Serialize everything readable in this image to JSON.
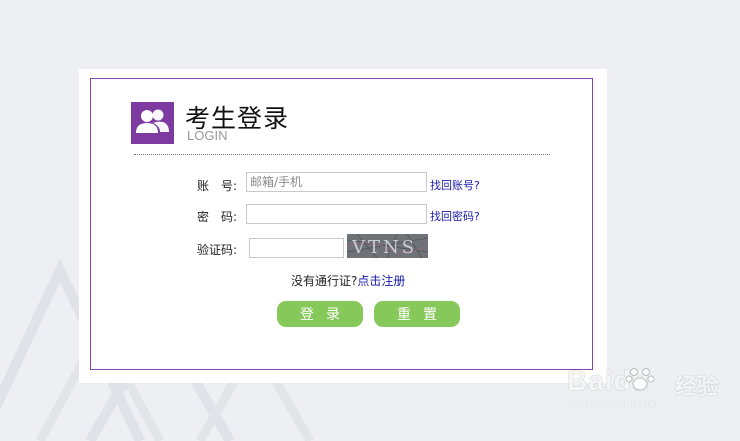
{
  "login": {
    "title": "考生登录",
    "subtitle": "LOGIN",
    "account_label": "账　号:",
    "account_placeholder": "邮箱/手机",
    "find_account_link": "找回账号?",
    "password_label": "密　码:",
    "find_password_link": "找回密码?",
    "captcha_label": "验证码:",
    "captcha_image_text": "VTNS",
    "no_pass_text": "没有通行证?",
    "register_link": "点击注册",
    "login_button": "登录",
    "reset_button": "重置"
  },
  "watermark": {
    "brand": "Baidu",
    "brand_cn": "经验",
    "url": "jingyan.baidu.com"
  },
  "colors": {
    "accent_purple": "#7d3aa1",
    "button_green": "#86c95a",
    "link_blue": "#1a1aa8",
    "background": "#edeff2"
  },
  "icons": {
    "header": "users-icon",
    "watermark": "paw-icon"
  }
}
